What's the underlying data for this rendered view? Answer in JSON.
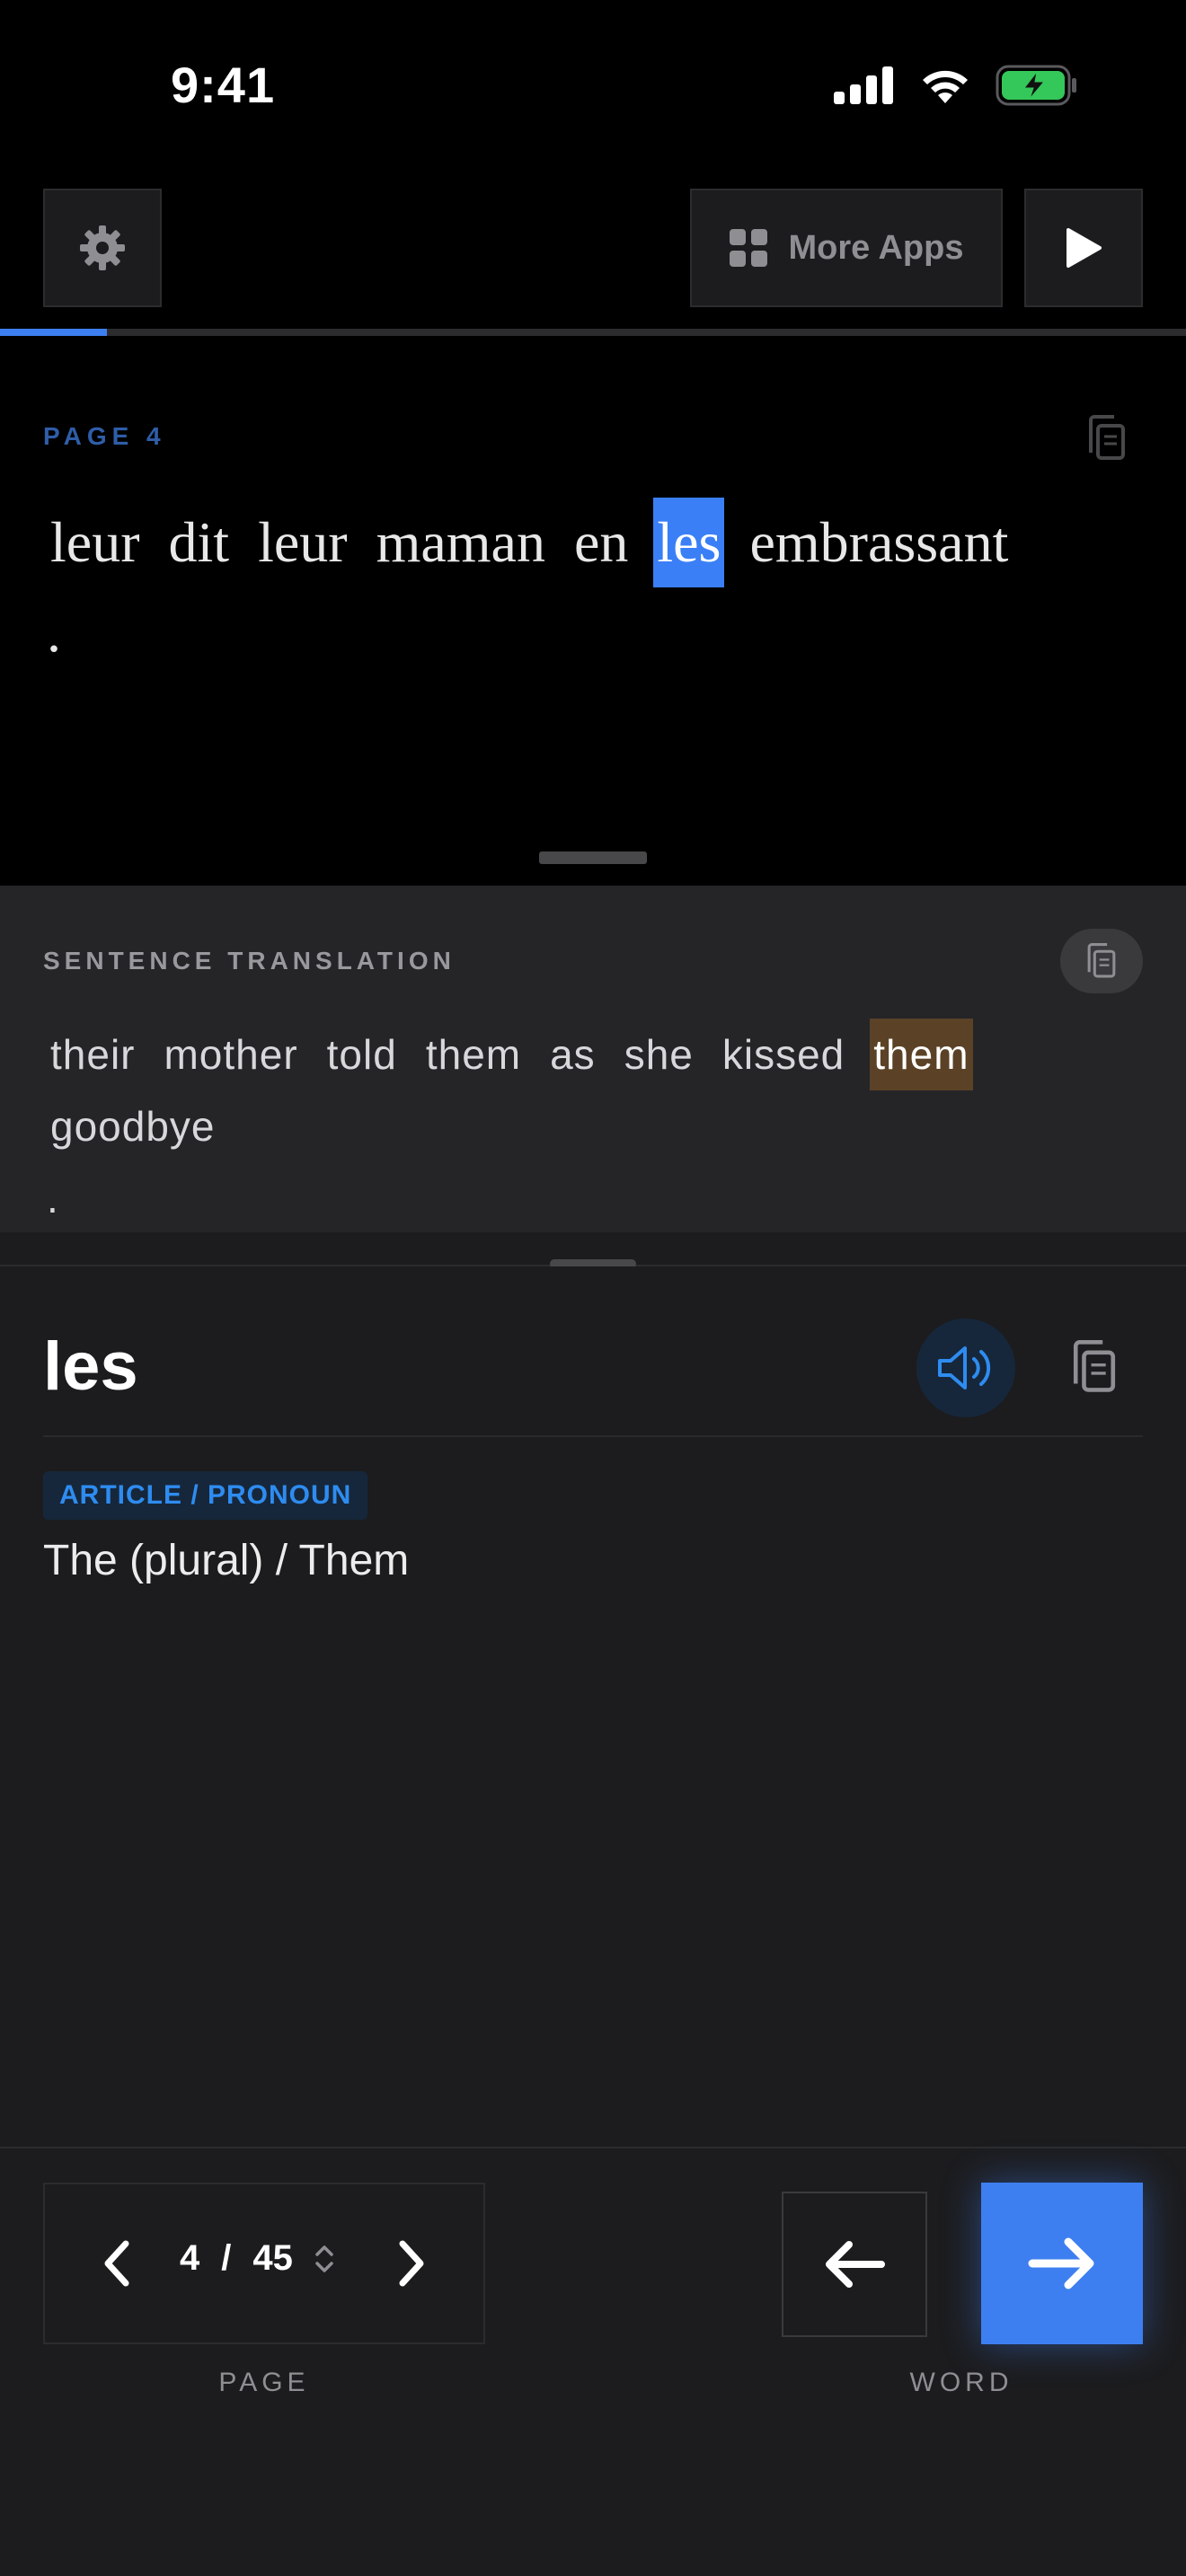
{
  "status_bar": {
    "time": "9:41"
  },
  "toolbar": {
    "more_apps_label": "More Apps",
    "reading_progress_percent": 9,
    "accent_color": "#3d7ff0"
  },
  "source": {
    "page_label": "PAGE 4",
    "words": [
      "leur",
      "dit",
      "leur",
      "maman",
      "en",
      "les",
      "embrassant"
    ],
    "highlighted_index": 5,
    "period": "."
  },
  "translation": {
    "label": "SENTENCE TRANSLATION",
    "words": [
      "their",
      "mother",
      "told",
      "them",
      "as",
      "she",
      "kissed",
      "them",
      "goodbye"
    ],
    "highlighted_index": 7,
    "period": "."
  },
  "word_detail": {
    "word": "les",
    "part_of_speech": "ARTICLE / PRONOUN",
    "definition": "The (plural) / Them"
  },
  "navigation": {
    "current_page": "4",
    "separator": "/",
    "total_pages": "45",
    "page_caption": "PAGE",
    "word_caption": "WORD"
  }
}
